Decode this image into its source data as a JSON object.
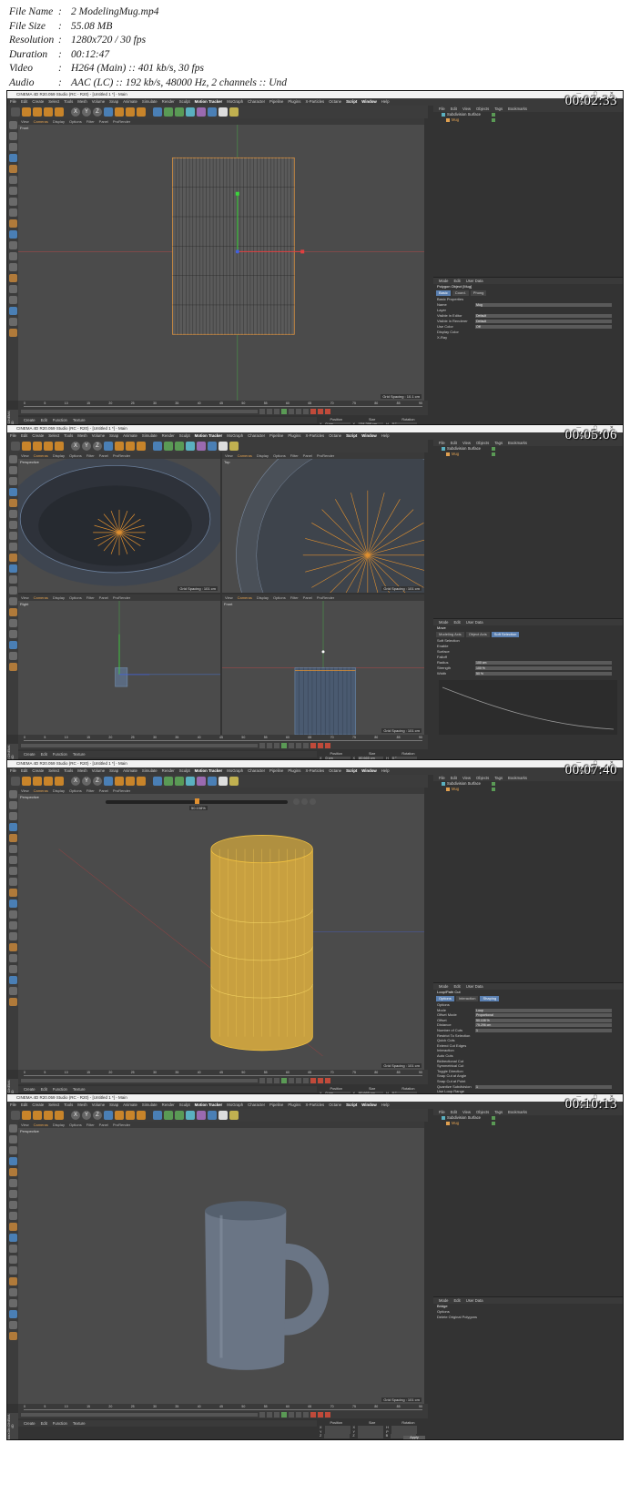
{
  "info": [
    {
      "key": "File Name",
      "value": "2 ModelingMug.mp4"
    },
    {
      "key": "File Size",
      "value": "55.08 MB"
    },
    {
      "key": "Resolution",
      "value": "1280x720 / 30 fps"
    },
    {
      "key": "Duration",
      "value": "00:12:47"
    },
    {
      "key": "Video",
      "value": "H264 (Main) :: 401 kb/s, 30 fps"
    },
    {
      "key": "Audio",
      "value": "AAC (LC) :: 192 kb/s, 48000 Hz, 2 channels :: Und"
    }
  ],
  "app_title": "CINEMA 4D R20.059 Studio (RC - R20) - [Untitled 1 *] - Main",
  "menu": [
    "File",
    "Edit",
    "Create",
    "Select",
    "Tools",
    "Mesh",
    "Volume",
    "Snap",
    "Animate",
    "Simulate",
    "Render",
    "Sculpt",
    "Motion Tracker",
    "MoGraph",
    "Character",
    "Pipeline",
    "Plugins",
    "X-Particles",
    "Octane",
    "Script",
    "Window",
    "Help"
  ],
  "layout_label": "Layout:",
  "layout_value": "Standard",
  "viewport_menu": [
    "View",
    "Cameras",
    "Display",
    "Options",
    "Filter",
    "Panel",
    "ProRender"
  ],
  "object_menu": [
    "File",
    "Edit",
    "View",
    "Objects",
    "Tags",
    "Bookmarks"
  ],
  "attr_menu": [
    "Mode",
    "Edit",
    "User Data"
  ],
  "material_menu": [
    "Create",
    "Edit",
    "Function",
    "Texture"
  ],
  "coord_headers": [
    "Position",
    "Size",
    "Rotation"
  ],
  "apply_label": "Apply",
  "object_label": "Object (Rel)",
  "size_label": "Size",
  "search_placeholder": "Type here to search",
  "maxon_label": "MAXON CINEMA 4D",
  "ruler_ticks": [
    "0",
    "5",
    "10",
    "15",
    "20",
    "25",
    "30",
    "35",
    "40",
    "45",
    "50",
    "55",
    "60",
    "65",
    "70",
    "75",
    "80",
    "85",
    "90"
  ],
  "frames": [
    {
      "timecode": "00:02:33",
      "grid_spacing": "Grid Spacing : 10.1 cm",
      "viewport_name": "Front",
      "objects": [
        "Subdivision Surface",
        "Mug"
      ],
      "attr_title": "Polygon Object [Mug]",
      "attr_tabs": [
        "Basic",
        "Coord.",
        "Phong"
      ],
      "attr_rows": [
        {
          "label": "Basic Properties",
          "value": ""
        },
        {
          "label": "Name",
          "value": "Mug"
        },
        {
          "label": "Layer",
          "value": ""
        },
        {
          "label": "Visible in Editor",
          "value": "Default"
        },
        {
          "label": "Visible in Renderer",
          "value": "Default"
        },
        {
          "label": "Use Color",
          "value": "Off"
        },
        {
          "label": "Display Color",
          "value": ""
        },
        {
          "label": "X-Ray",
          "value": ""
        }
      ],
      "coords": [
        [
          "X",
          "0 cm",
          "X",
          "134.298 cm",
          "H",
          "0 °"
        ],
        [
          "Y",
          "0 cm",
          "Y",
          "134.278 cm",
          "P",
          "0 °"
        ],
        [
          "Z",
          "0 cm",
          "Z",
          "96.592 cm",
          "B",
          "0 °"
        ]
      ],
      "status": "Scale: Click and drag to scale elements. Hold down SHIFT to quantize scale / add to the selection in point mode, CTRL to remove.",
      "clock": [
        "11:28 AM",
        "8/10/2020"
      ]
    },
    {
      "timecode": "00:05:06",
      "grid_spacing": "Grid Spacing : 101 cm",
      "viewport_name": "Perspective",
      "viewport_names": [
        "Perspective",
        "Top",
        "Right",
        "Front"
      ],
      "objects": [
        "Subdivision Surface",
        "Mug"
      ],
      "attr_title": "Move",
      "attr_tabs": [
        "Modeling Axis",
        "Object Axis",
        "Soft Selection"
      ],
      "attr_rows": [
        {
          "label": "Soft Selection",
          "value": ""
        },
        {
          "label": "Enable",
          "value": ""
        },
        {
          "label": "Surface",
          "value": ""
        },
        {
          "label": "Falloff",
          "value": ""
        },
        {
          "label": "Radius",
          "value": "100 cm"
        },
        {
          "label": "Strength",
          "value": "100 %"
        },
        {
          "label": "Width",
          "value": "50 %"
        }
      ],
      "coords": [
        [
          "X",
          "0 cm",
          "X",
          "80.665 cm",
          "H",
          "0 °"
        ],
        [
          "Y",
          "49.775 cm",
          "Y",
          "0 cm",
          "P",
          "0 °"
        ],
        [
          "Z",
          "0 cm",
          "Z",
          "80.669 cm",
          "B",
          "0 °"
        ]
      ],
      "status": "",
      "clock": [
        "11:30 AM",
        "8/10/2020"
      ]
    },
    {
      "timecode": "00:07:40",
      "grid_spacing": "Grid Spacing : 101 cm",
      "viewport_name": "Perspective",
      "slider_value": "50.108%",
      "objects": [
        "Subdivision Surface",
        "Mug"
      ],
      "attr_title": "Loop/Path Cut",
      "attr_tabs": [
        "Options",
        "Interaction",
        "Shaping"
      ],
      "attr_rows": [
        {
          "label": "Options",
          "value": ""
        },
        {
          "label": "Mode",
          "value": "Loop"
        },
        {
          "label": "Offset Mode",
          "value": "Proportional"
        },
        {
          "label": "Offset",
          "value": "50.108 %"
        },
        {
          "label": "Distance",
          "value": "75.296 cm"
        },
        {
          "label": "Number of Cuts",
          "value": "1"
        },
        {
          "label": "Restrict To Selection",
          "value": ""
        },
        {
          "label": "Quick Cuts",
          "value": ""
        },
        {
          "label": "Extend Cut Edges",
          "value": ""
        },
        {
          "label": "Interaction",
          "value": ""
        },
        {
          "label": "Auto Cuts",
          "value": ""
        },
        {
          "label": "Bidirectional Cut",
          "value": ""
        },
        {
          "label": "Symmetrical Cut",
          "value": ""
        },
        {
          "label": "Toggle Direction",
          "value": ""
        },
        {
          "label": "Snap Cut at Angle",
          "value": ""
        },
        {
          "label": "Snap Cut at Point",
          "value": ""
        },
        {
          "label": "Quantize Subdivision",
          "value": "1"
        },
        {
          "label": "Use Loop Range",
          "value": ""
        },
        {
          "label": "Shaping",
          "value": ""
        },
        {
          "label": "Preserve Curvature",
          "value": ""
        },
        {
          "label": "Tension",
          "value": ""
        },
        {
          "label": "Profile",
          "value": ""
        }
      ],
      "coords": [
        [
          "X",
          "0 cm",
          "X",
          "80.665 cm",
          "H",
          "0 °"
        ],
        [
          "Y",
          "0 cm",
          "Y",
          "134.278 cm",
          "P",
          "0 °"
        ],
        [
          "Z",
          "0 cm",
          "Z",
          "80.669 cm",
          "B",
          "0 °"
        ]
      ],
      "status": "",
      "clock": [
        "11:32 AM",
        "8/10/2020"
      ]
    },
    {
      "timecode": "00:10:13",
      "grid_spacing": "Grid Spacing : 101 cm",
      "viewport_name": "Perspective",
      "objects": [
        "Subdivision Surface",
        "Mug"
      ],
      "attr_title": "Bridge",
      "attr_tabs": [],
      "attr_rows": [
        {
          "label": "Options",
          "value": ""
        },
        {
          "label": "Delete Original Polygons",
          "value": ""
        }
      ],
      "coords": [
        [
          "X",
          "",
          "X",
          "",
          "H",
          ""
        ],
        [
          "Y",
          "",
          "Y",
          "",
          "P",
          ""
        ],
        [
          "Z",
          "",
          "Z",
          "",
          "B",
          ""
        ]
      ],
      "status": "",
      "clock": [
        "11:35 AM",
        "8/10/2020"
      ]
    }
  ],
  "colors": {
    "bg": "#333333",
    "viewport": "#4b4b4b",
    "accent": "#e0a050",
    "selection": "#5a7fb0"
  }
}
